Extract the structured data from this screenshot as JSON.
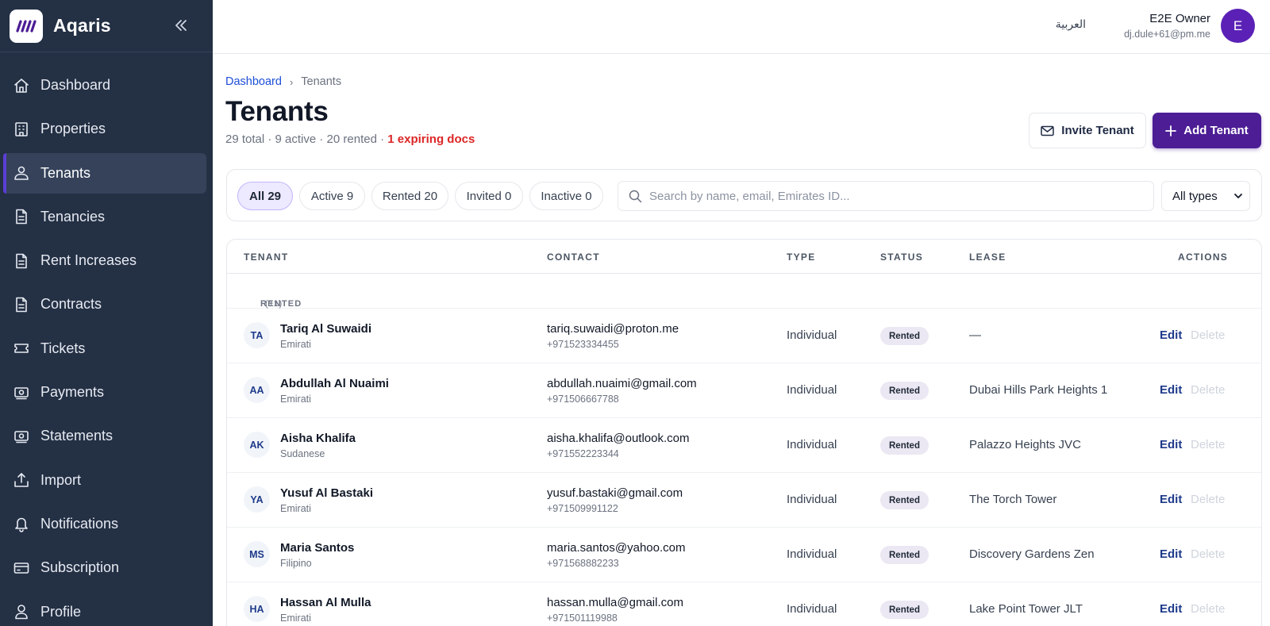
{
  "app": {
    "name": "Aqaris"
  },
  "sidebar": {
    "items": [
      {
        "label": "Dashboard",
        "icon": "home-icon",
        "active": false
      },
      {
        "label": "Properties",
        "icon": "building-icon",
        "active": false
      },
      {
        "label": "Tenants",
        "icon": "users-icon",
        "active": true
      },
      {
        "label": "Tenancies",
        "icon": "document-icon",
        "active": false
      },
      {
        "label": "Rent Increases",
        "icon": "document-icon",
        "active": false
      },
      {
        "label": "Contracts",
        "icon": "document-icon",
        "active": false
      },
      {
        "label": "Tickets",
        "icon": "ticket-icon",
        "active": false
      },
      {
        "label": "Payments",
        "icon": "cash-icon",
        "active": false
      },
      {
        "label": "Statements",
        "icon": "cash-icon",
        "active": false
      },
      {
        "label": "Import",
        "icon": "upload-icon",
        "active": false
      },
      {
        "label": "Notifications",
        "icon": "bell-icon",
        "active": false
      },
      {
        "label": "Subscription",
        "icon": "credit-card-icon",
        "active": false
      },
      {
        "label": "Profile",
        "icon": "user-icon",
        "active": false
      }
    ]
  },
  "topbar": {
    "language": "العربية",
    "user_name": "E2E Owner",
    "user_email": "dj.dule+61@pm.me",
    "avatar_initial": "E"
  },
  "breadcrumb": {
    "home": "Dashboard",
    "separator": "›",
    "current": "Tenants"
  },
  "page": {
    "title": "Tenants",
    "summary": "29 total · 9 active · 20 rented · ",
    "summary_warning": "1 expiring docs"
  },
  "actions": {
    "invite": "Invite Tenant",
    "add": "Add Tenant"
  },
  "filters": {
    "pills": [
      {
        "label": "All 29",
        "active": true
      },
      {
        "label": "Active 9",
        "active": false
      },
      {
        "label": "Rented 20",
        "active": false
      },
      {
        "label": "Invited 0",
        "active": false
      },
      {
        "label": "Inactive 0",
        "active": false
      }
    ],
    "search_placeholder": "Search by name, email, Emirates ID...",
    "type_select": "All types"
  },
  "table": {
    "headers": {
      "tenant": "TENANT",
      "contact": "CONTACT",
      "type": "TYPE",
      "status": "STATUS",
      "lease": "LEASE",
      "actions": "ACTIONS"
    },
    "group": {
      "label": "RENTED",
      "count": "(11)"
    },
    "edit_label": "Edit",
    "delete_label": "Delete",
    "rows": [
      {
        "initials": "TA",
        "name": "Tariq Al Suwaidi",
        "nationality": "Emirati",
        "email": "tariq.suwaidi@proton.me",
        "phone": "+971523334455",
        "type": "Individual",
        "status": "Rented",
        "lease": "—"
      },
      {
        "initials": "AA",
        "name": "Abdullah Al Nuaimi",
        "nationality": "Emirati",
        "email": "abdullah.nuaimi@gmail.com",
        "phone": "+971506667788",
        "type": "Individual",
        "status": "Rented",
        "lease": "Dubai Hills Park Heights 1"
      },
      {
        "initials": "AK",
        "name": "Aisha Khalifa",
        "nationality": "Sudanese",
        "email": "aisha.khalifa@outlook.com",
        "phone": "+971552223344",
        "type": "Individual",
        "status": "Rented",
        "lease": "Palazzo Heights JVC"
      },
      {
        "initials": "YA",
        "name": "Yusuf Al Bastaki",
        "nationality": "Emirati",
        "email": "yusuf.bastaki@gmail.com",
        "phone": "+971509991122",
        "type": "Individual",
        "status": "Rented",
        "lease": "The Torch Tower"
      },
      {
        "initials": "MS",
        "name": "Maria Santos",
        "nationality": "Filipino",
        "email": "maria.santos@yahoo.com",
        "phone": "+971568882233",
        "type": "Individual",
        "status": "Rented",
        "lease": "Discovery Gardens Zen"
      },
      {
        "initials": "HA",
        "name": "Hassan Al Mulla",
        "nationality": "Emirati",
        "email": "hassan.mulla@gmail.com",
        "phone": "+971501119988",
        "type": "Individual",
        "status": "Rented",
        "lease": "Lake Point Tower JLT"
      }
    ]
  },
  "colors": {
    "sidebar": "#243044",
    "accent": "#4c1d95",
    "warning": "#dc2626",
    "link": "#1d4ed8"
  }
}
